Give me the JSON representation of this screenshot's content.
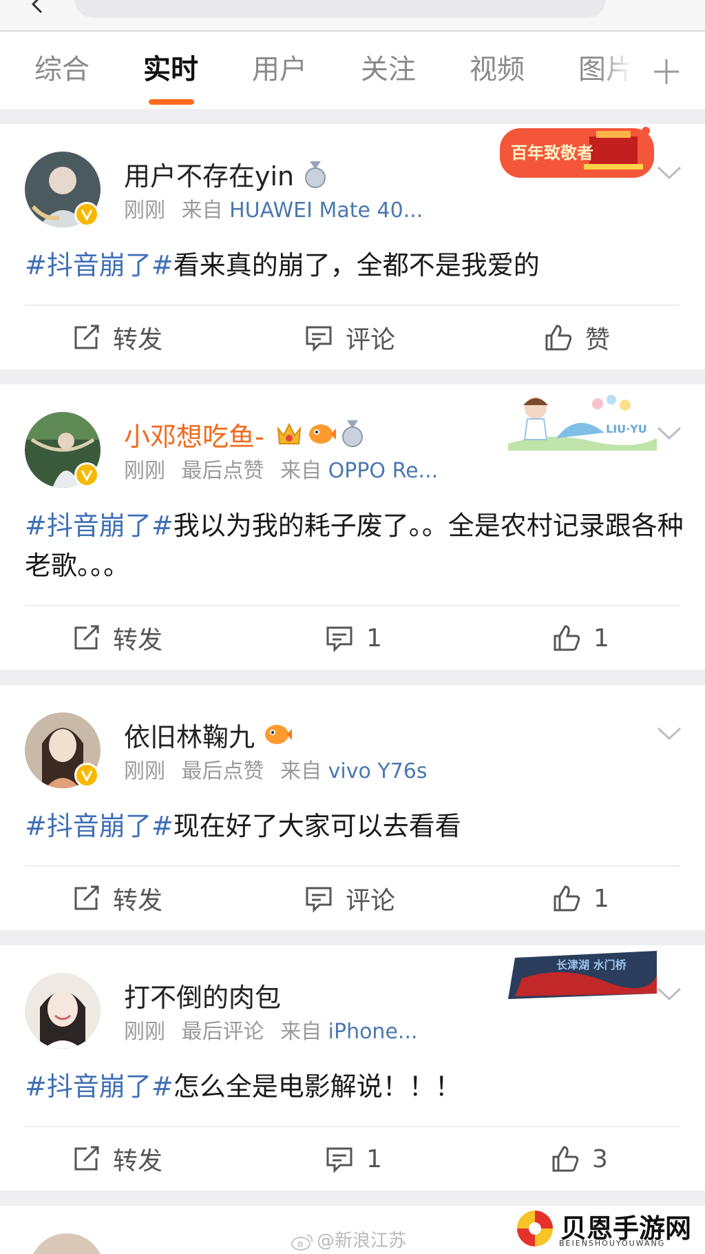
{
  "tabs": [
    {
      "label": "综合"
    },
    {
      "label": "实时",
      "active": true
    },
    {
      "label": "用户"
    },
    {
      "label": "关注"
    },
    {
      "label": "视频"
    },
    {
      "label": "图片"
    }
  ],
  "accent_color": "#ff6a1a",
  "link_color": "#3f6fb5",
  "posts": [
    {
      "username": "用户不存在yin",
      "time": "刚刚",
      "meta_extra": "",
      "source_prefix": "来自",
      "source": "HUAWEI Mate 40...",
      "hashtag": "#抖音崩了#",
      "text": "看来真的崩了，全都不是我爱的",
      "banner_text": "百年致敬者",
      "actions": {
        "repost": "转发",
        "comment": "评论",
        "like": "赞"
      }
    },
    {
      "username": "小邓想吃鱼-",
      "time": "刚刚",
      "meta_extra": "最后点赞",
      "source_prefix": "来自",
      "source": "OPPO Re...",
      "hashtag": "#抖音崩了#",
      "text": "我以为我的耗子废了。。全是农村记录跟各种老歌。。。",
      "banner_text": "LIU·YU",
      "actions": {
        "repost": "转发",
        "comment": "1",
        "like": "1"
      }
    },
    {
      "username": "依旧林鞠九",
      "time": "刚刚",
      "meta_extra": "最后点赞",
      "source_prefix": "来自",
      "source": "vivo Y76s",
      "hashtag": "#抖音崩了#",
      "text": "现在好了大家可以去看看",
      "actions": {
        "repost": "转发",
        "comment": "评论",
        "like": "1"
      }
    },
    {
      "username": "打不倒的肉包",
      "time": "刚刚",
      "meta_extra": "最后评论",
      "source_prefix": "来自",
      "source": "iPhone...",
      "hashtag": "#抖音崩了#",
      "text": "怎么全是电影解说！！！",
      "banner_text": "长津湖 水门桥",
      "actions": {
        "repost": "转发",
        "comment": "1",
        "like": "3"
      }
    }
  ],
  "footer": {
    "watermark": "@新浪江苏",
    "site_name": "贝恩手游网",
    "site_pinyin": "BEIENSHOUYOUWANG"
  }
}
